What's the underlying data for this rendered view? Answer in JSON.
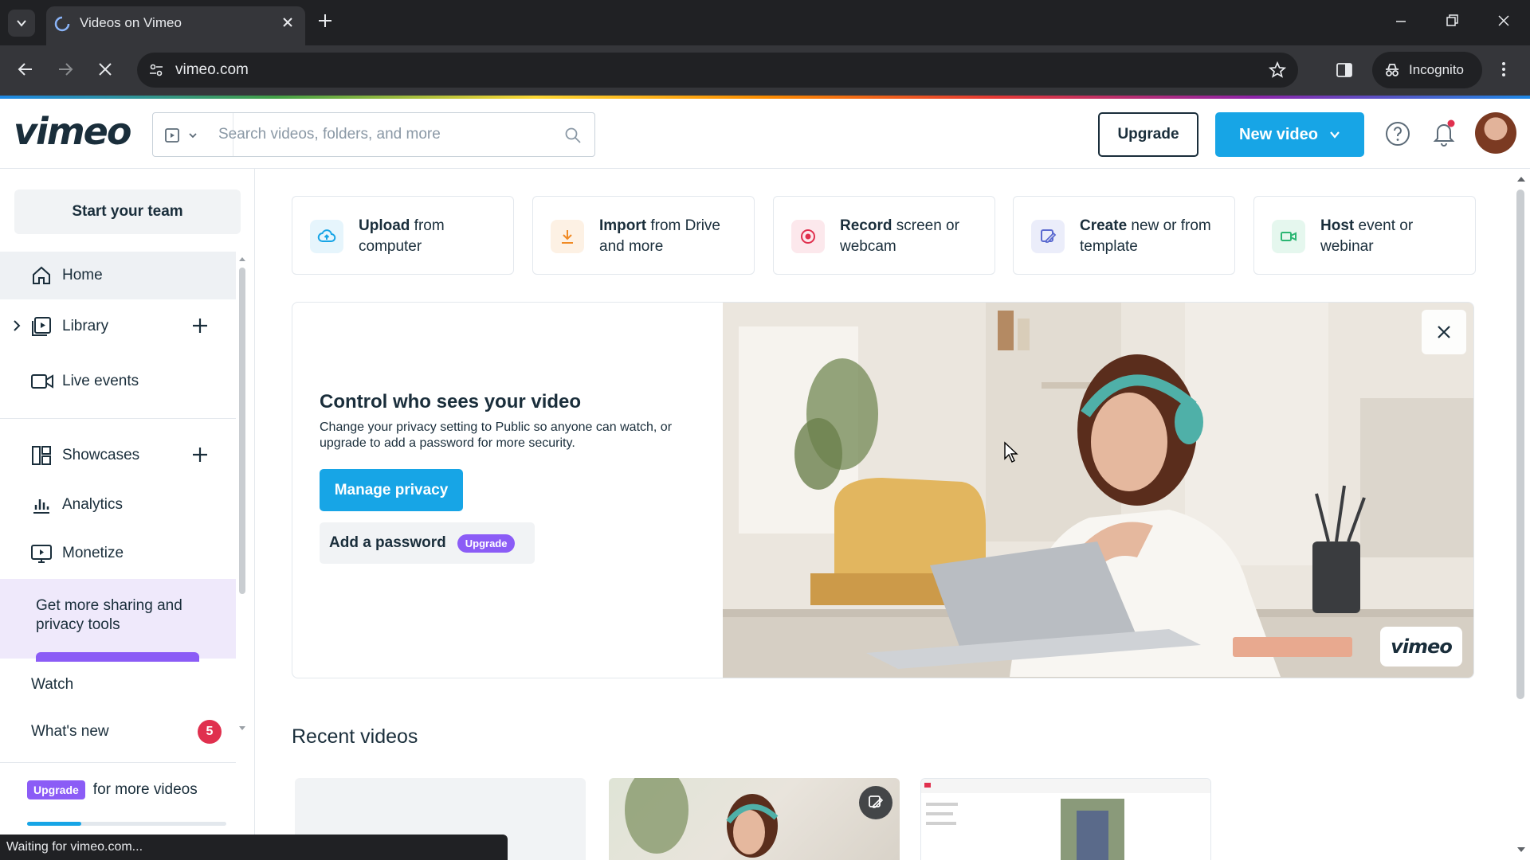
{
  "browser": {
    "tab_title": "Videos on Vimeo",
    "url": "vimeo.com",
    "incognito_label": "Incognito",
    "status_text": "Waiting for vimeo.com..."
  },
  "header": {
    "logo": "vimeo",
    "search_placeholder": "Search videos, folders, and more",
    "upgrade_label": "Upgrade",
    "new_video_label": "New video"
  },
  "sidebar": {
    "start_team": "Start your team",
    "items": [
      {
        "label": "Home",
        "icon": "home-icon"
      },
      {
        "label": "Library",
        "icon": "library-icon"
      },
      {
        "label": "Live events",
        "icon": "camera-icon"
      },
      {
        "label": "Showcases",
        "icon": "showcases-icon"
      },
      {
        "label": "Analytics",
        "icon": "analytics-icon"
      },
      {
        "label": "Monetize",
        "icon": "monetize-icon"
      }
    ],
    "promo_text": "Get more sharing and privacy tools",
    "watch": "Watch",
    "whats_new": "What's new",
    "whats_new_count": "5",
    "upgrade_pill": "Upgrade",
    "upgrade_text": "for more videos",
    "usage_fraction": 0.27
  },
  "quick_actions": [
    {
      "bold": "Upload",
      "rest": " from computer",
      "icon": "upload-cloud-icon",
      "color": "#17a5e6",
      "bg": "#e6f5fc"
    },
    {
      "bold": "Import",
      "rest": " from Drive and more",
      "icon": "download-icon",
      "color": "#f08a24",
      "bg": "#fdf1e4"
    },
    {
      "bold": "Record",
      "rest": " screen or webcam",
      "icon": "record-icon",
      "color": "#e0304e",
      "bg": "#fce8ec"
    },
    {
      "bold": "Create",
      "rest": " new or from template",
      "icon": "create-icon",
      "color": "#5b6ad0",
      "bg": "#ebedfa"
    },
    {
      "bold": "Host",
      "rest": " event or webinar",
      "icon": "host-camera-icon",
      "color": "#2bb673",
      "bg": "#e5f7ee"
    }
  ],
  "privacy": {
    "title": "Control who sees your video",
    "description": "Change your privacy setting to Public so anyone can watch, or upgrade to add a password for more security.",
    "manage_label": "Manage privacy",
    "password_label": "Add a password",
    "upgrade_pill": "Upgrade",
    "hero_logo": "vimeo"
  },
  "recent": {
    "title": "Recent videos"
  },
  "colors": {
    "accent": "#17a5e6",
    "upgrade_purple": "#8b5cf6",
    "text": "#1a2e3b",
    "badge_red": "#e0304e"
  }
}
